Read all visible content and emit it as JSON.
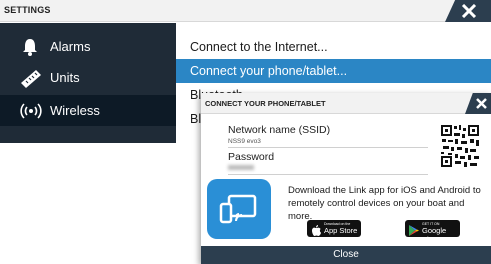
{
  "settings": {
    "title": "SETTINGS",
    "sidebar": [
      {
        "label": "Alarms",
        "icon": "bell-icon"
      },
      {
        "label": "Units",
        "icon": "ruler-icon"
      },
      {
        "label": "Wireless",
        "icon": "wireless-icon",
        "active": true
      }
    ],
    "options": [
      {
        "label": "Connect to the Internet..."
      },
      {
        "label": "Connect your phone/tablet...",
        "selected": true
      },
      {
        "label": "Bluetooth"
      },
      {
        "label": "Bl"
      }
    ]
  },
  "dialog": {
    "title": "CONNECT YOUR PHONE/TABLET",
    "network_label": "Network name (SSID)",
    "network_value": "NSS9 evo3",
    "password_label": "Password",
    "app_text": "Download the Link app for iOS and Android to remotely control devices on your boat and more.",
    "app_store": {
      "small": "Download on the",
      "big": "App Store"
    },
    "google_play": {
      "small": "GET IT ON",
      "big": "Google Play"
    },
    "close_label": "Close"
  },
  "colors": {
    "accent": "#2b86c5",
    "header_dark": "#2c3e4f",
    "sidebar_bg": "#1f2b37",
    "app_icon_bg": "#2a8fd6"
  }
}
